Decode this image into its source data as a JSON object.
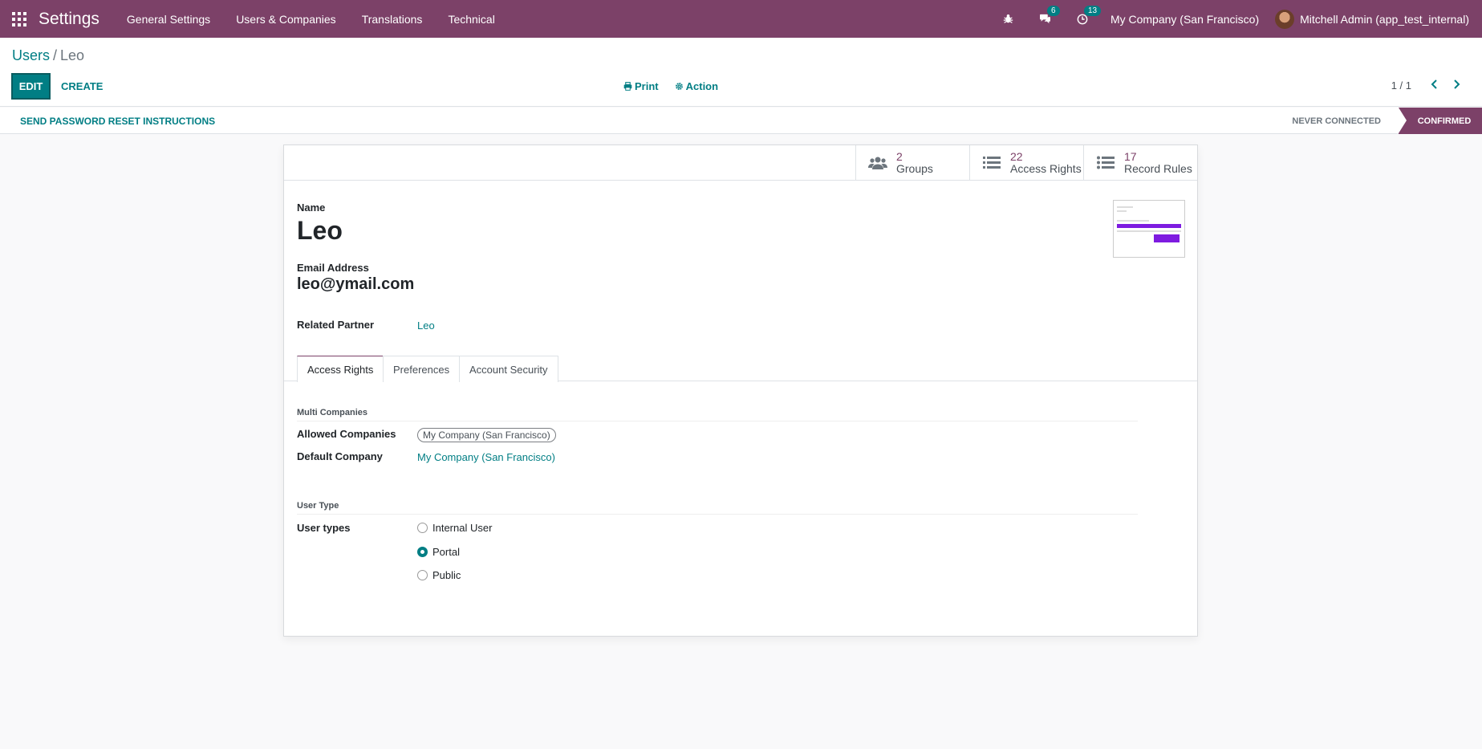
{
  "navbar": {
    "brand": "Settings",
    "menu": [
      "General Settings",
      "Users & Companies",
      "Translations",
      "Technical"
    ],
    "chat_count": "6",
    "activity_count": "13",
    "company": "My Company (San Francisco)",
    "user": "Mitchell Admin (app_test_internal)"
  },
  "control_panel": {
    "breadcrumb_parent": "Users",
    "breadcrumb_sep": "/",
    "breadcrumb_current": "Leo",
    "edit_label": "EDIT",
    "create_label": "CREATE",
    "print_label": "Print",
    "action_label": "Action",
    "pager": "1 / 1"
  },
  "statusbar": {
    "reset_label": "SEND PASSWORD RESET INSTRUCTIONS",
    "stage_never": "NEVER CONNECTED",
    "stage_confirmed": "CONFIRMED"
  },
  "stats": [
    {
      "num": "2",
      "label": "Groups"
    },
    {
      "num": "22",
      "label": "Access Rights"
    },
    {
      "num": "17",
      "label": "Record Rules"
    }
  ],
  "form": {
    "name_label": "Name",
    "name_value": "Leo",
    "email_label": "Email Address",
    "email_value": "leo@ymail.com",
    "partner_label": "Related Partner",
    "partner_value": "Leo"
  },
  "tabs": [
    "Access Rights",
    "Preferences",
    "Account Security"
  ],
  "access": {
    "multi_title": "Multi Companies",
    "allowed_label": "Allowed Companies",
    "allowed_tag": "My Company (San Francisco)",
    "default_label": "Default Company",
    "default_value": "My Company (San Francisco)",
    "usertype_title": "User Type",
    "usertypes_label": "User types",
    "options": [
      "Internal User",
      "Portal",
      "Public"
    ],
    "selected": "Portal"
  },
  "colors": {
    "navbar": "#7c4168",
    "accent": "#017e84"
  }
}
